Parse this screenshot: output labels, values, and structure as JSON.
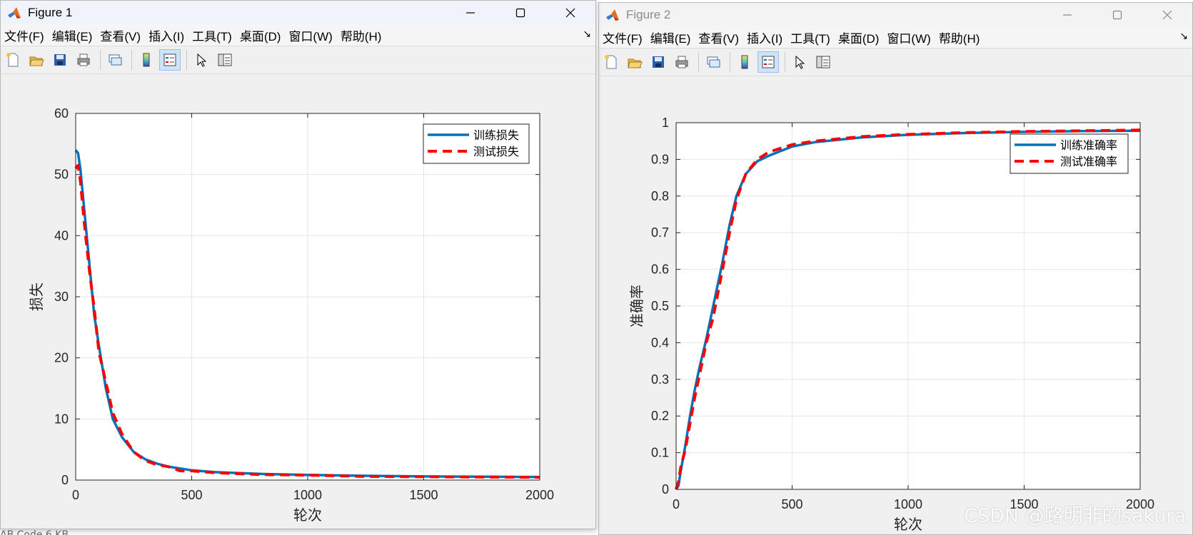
{
  "windows": [
    {
      "title": "Figure 1",
      "menu": [
        "文件(F)",
        "编辑(E)",
        "查看(V)",
        "插入(I)",
        "工具(T)",
        "桌面(D)",
        "窗口(W)",
        "帮助(H)"
      ],
      "chart_data": {
        "type": "line",
        "title": "",
        "xlabel": "轮次",
        "ylabel": "损失",
        "xlim": [
          0,
          2000
        ],
        "ylim": [
          0,
          60
        ],
        "xticks": [
          0,
          500,
          1000,
          1500,
          2000
        ],
        "yticks": [
          0,
          10,
          20,
          30,
          40,
          50,
          60
        ],
        "grid": true,
        "legend_position": "top-right",
        "series": [
          {
            "name": "训练损失",
            "style": "solid",
            "color": "#0072BD",
            "x": [
              0,
              10,
              20,
              40,
              60,
              80,
              100,
              130,
              160,
              200,
              250,
              300,
              350,
              400,
              500,
              600,
              800,
              1000,
              1250,
              1500,
              1750,
              2000
            ],
            "y": [
              54,
              53.5,
              51,
              43,
              35,
              27,
              22,
              15,
              10,
              7,
              4.6,
              3.4,
              2.7,
              2.2,
              1.6,
              1.3,
              1.0,
              0.85,
              0.7,
              0.6,
              0.55,
              0.5
            ]
          },
          {
            "name": "测试损失",
            "style": "dashed",
            "color": "#FF0000",
            "x": [
              0,
              10,
              20,
              40,
              60,
              80,
              100,
              130,
              160,
              200,
              250,
              300,
              350,
              400,
              450,
              500,
              600,
              800,
              1000,
              1250,
              1500,
              1750,
              2000
            ],
            "y": [
              51,
              51.5,
              49,
              41,
              34,
              28,
              21,
              16,
              11,
              7.5,
              4.6,
              3.2,
              2.5,
              2.2,
              1.5,
              1.5,
              1.2,
              0.9,
              0.8,
              0.6,
              0.55,
              0.5,
              0.45
            ]
          }
        ]
      }
    },
    {
      "title": "Figure 2",
      "menu": [
        "文件(F)",
        "编辑(E)",
        "查看(V)",
        "插入(I)",
        "工具(T)",
        "桌面(D)",
        "窗口(W)",
        "帮助(H)"
      ],
      "chart_data": {
        "type": "line",
        "title": "",
        "xlabel": "轮次",
        "ylabel": "准确率",
        "xlim": [
          0,
          2000
        ],
        "ylim": [
          0,
          1
        ],
        "xticks": [
          0,
          500,
          1000,
          1500,
          2000
        ],
        "yticks": [
          0,
          0.1,
          0.2,
          0.3,
          0.4,
          0.5,
          0.6,
          0.7,
          0.8,
          0.9,
          1
        ],
        "grid": true,
        "legend_position": "top-right",
        "series": [
          {
            "name": "训练准确率",
            "style": "solid",
            "color": "#0072BD",
            "x": [
              0,
              10,
              20,
              40,
              60,
              80,
              100,
              130,
              160,
              200,
              230,
              260,
              300,
              350,
              400,
              500,
              600,
              800,
              1000,
              1250,
              1500,
              1750,
              2000
            ],
            "y": [
              0,
              0.01,
              0.05,
              0.12,
              0.2,
              0.27,
              0.33,
              0.41,
              0.5,
              0.62,
              0.72,
              0.8,
              0.86,
              0.895,
              0.91,
              0.935,
              0.947,
              0.96,
              0.967,
              0.972,
              0.975,
              0.977,
              0.978
            ]
          },
          {
            "name": "测试准确率",
            "style": "dashed",
            "color": "#FF0000",
            "x": [
              0,
              10,
              20,
              40,
              60,
              80,
              100,
              130,
              160,
              200,
              230,
              260,
              300,
              350,
              400,
              500,
              600,
              800,
              1000,
              1250,
              1500,
              1750,
              2000
            ],
            "y": [
              0,
              0.02,
              0.06,
              0.11,
              0.18,
              0.25,
              0.31,
              0.4,
              0.47,
              0.6,
              0.7,
              0.79,
              0.86,
              0.9,
              0.92,
              0.94,
              0.95,
              0.962,
              0.968,
              0.973,
              0.976,
              0.978,
              0.98
            ]
          }
        ]
      }
    }
  ],
  "watermark": "CSDN @路明非的sakura",
  "status_fragment": "AB Code          6 KB",
  "colors": {
    "axes_bg": "#ffffff",
    "window_bg": "#f0f0f0",
    "grid": "#e6e6e6"
  }
}
